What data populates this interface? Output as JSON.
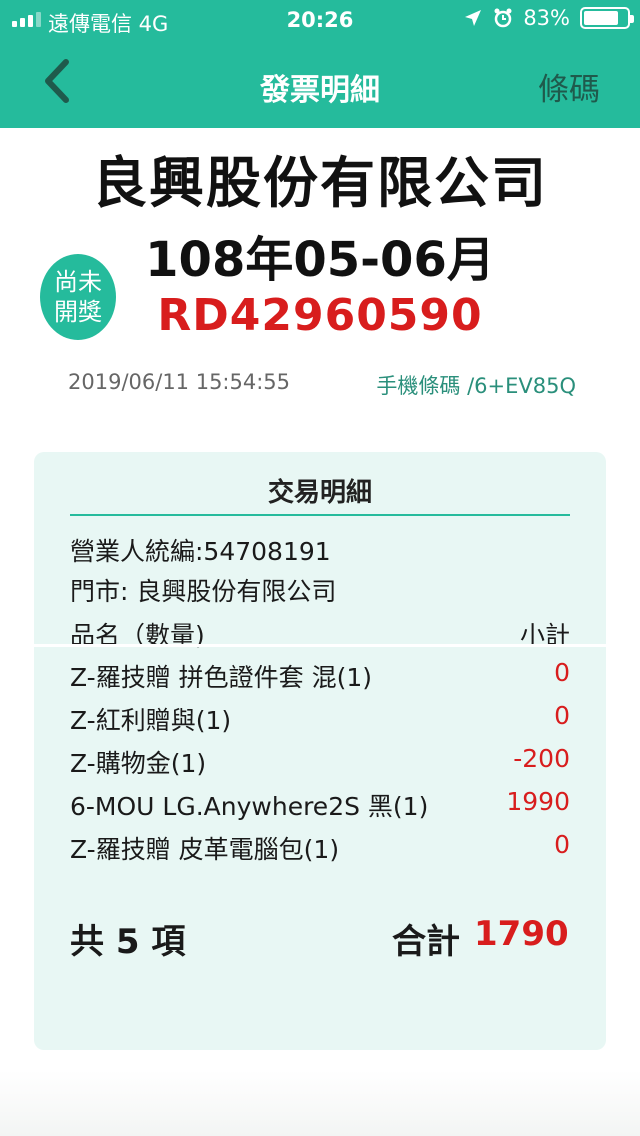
{
  "status_bar": {
    "carrier": "遠傳電信  4G",
    "time": "20:26",
    "battery": "83%",
    "battery_level": 0.83,
    "icons": [
      "signal-icon",
      "location-icon",
      "alarm-icon",
      "battery-icon"
    ]
  },
  "nav": {
    "back_icon": "chevron-left-icon",
    "title": "發票明細",
    "barcode_label": "條碼"
  },
  "invoice": {
    "company": "良興股份有限公司",
    "period": "108年05-06月",
    "number": "RD42960590",
    "badge_line1": "尚未",
    "badge_line2": "開獎",
    "datetime": "2019/06/11 15:54:55",
    "carrier_info": "手機條碼 /6+EV85Q"
  },
  "detail": {
    "title": "交易明細",
    "seller_id": "營業人統編:54708191",
    "store": "門市: 良興股份有限公司",
    "col_item": "品名（數量)",
    "col_subtotal": "小計",
    "items": [
      {
        "name": "Z-羅技贈 拼色證件套 混(1)",
        "subtotal": "0"
      },
      {
        "name": "Z-紅利贈與(1)",
        "subtotal": "0"
      },
      {
        "name": "Z-購物金(1)",
        "subtotal": "-200"
      },
      {
        "name": "6-MOU LG.Anywhere2S 黑(1)",
        "subtotal": "1990"
      },
      {
        "name": "Z-羅技贈 皮革電腦包(1)",
        "subtotal": "0"
      }
    ],
    "count_label": "共 5 項",
    "total_label": "合計",
    "total_value": "1790"
  },
  "colors": {
    "accent": "#25bb9c",
    "red": "#d81d1d",
    "card_bg": "#e8f7f4"
  }
}
